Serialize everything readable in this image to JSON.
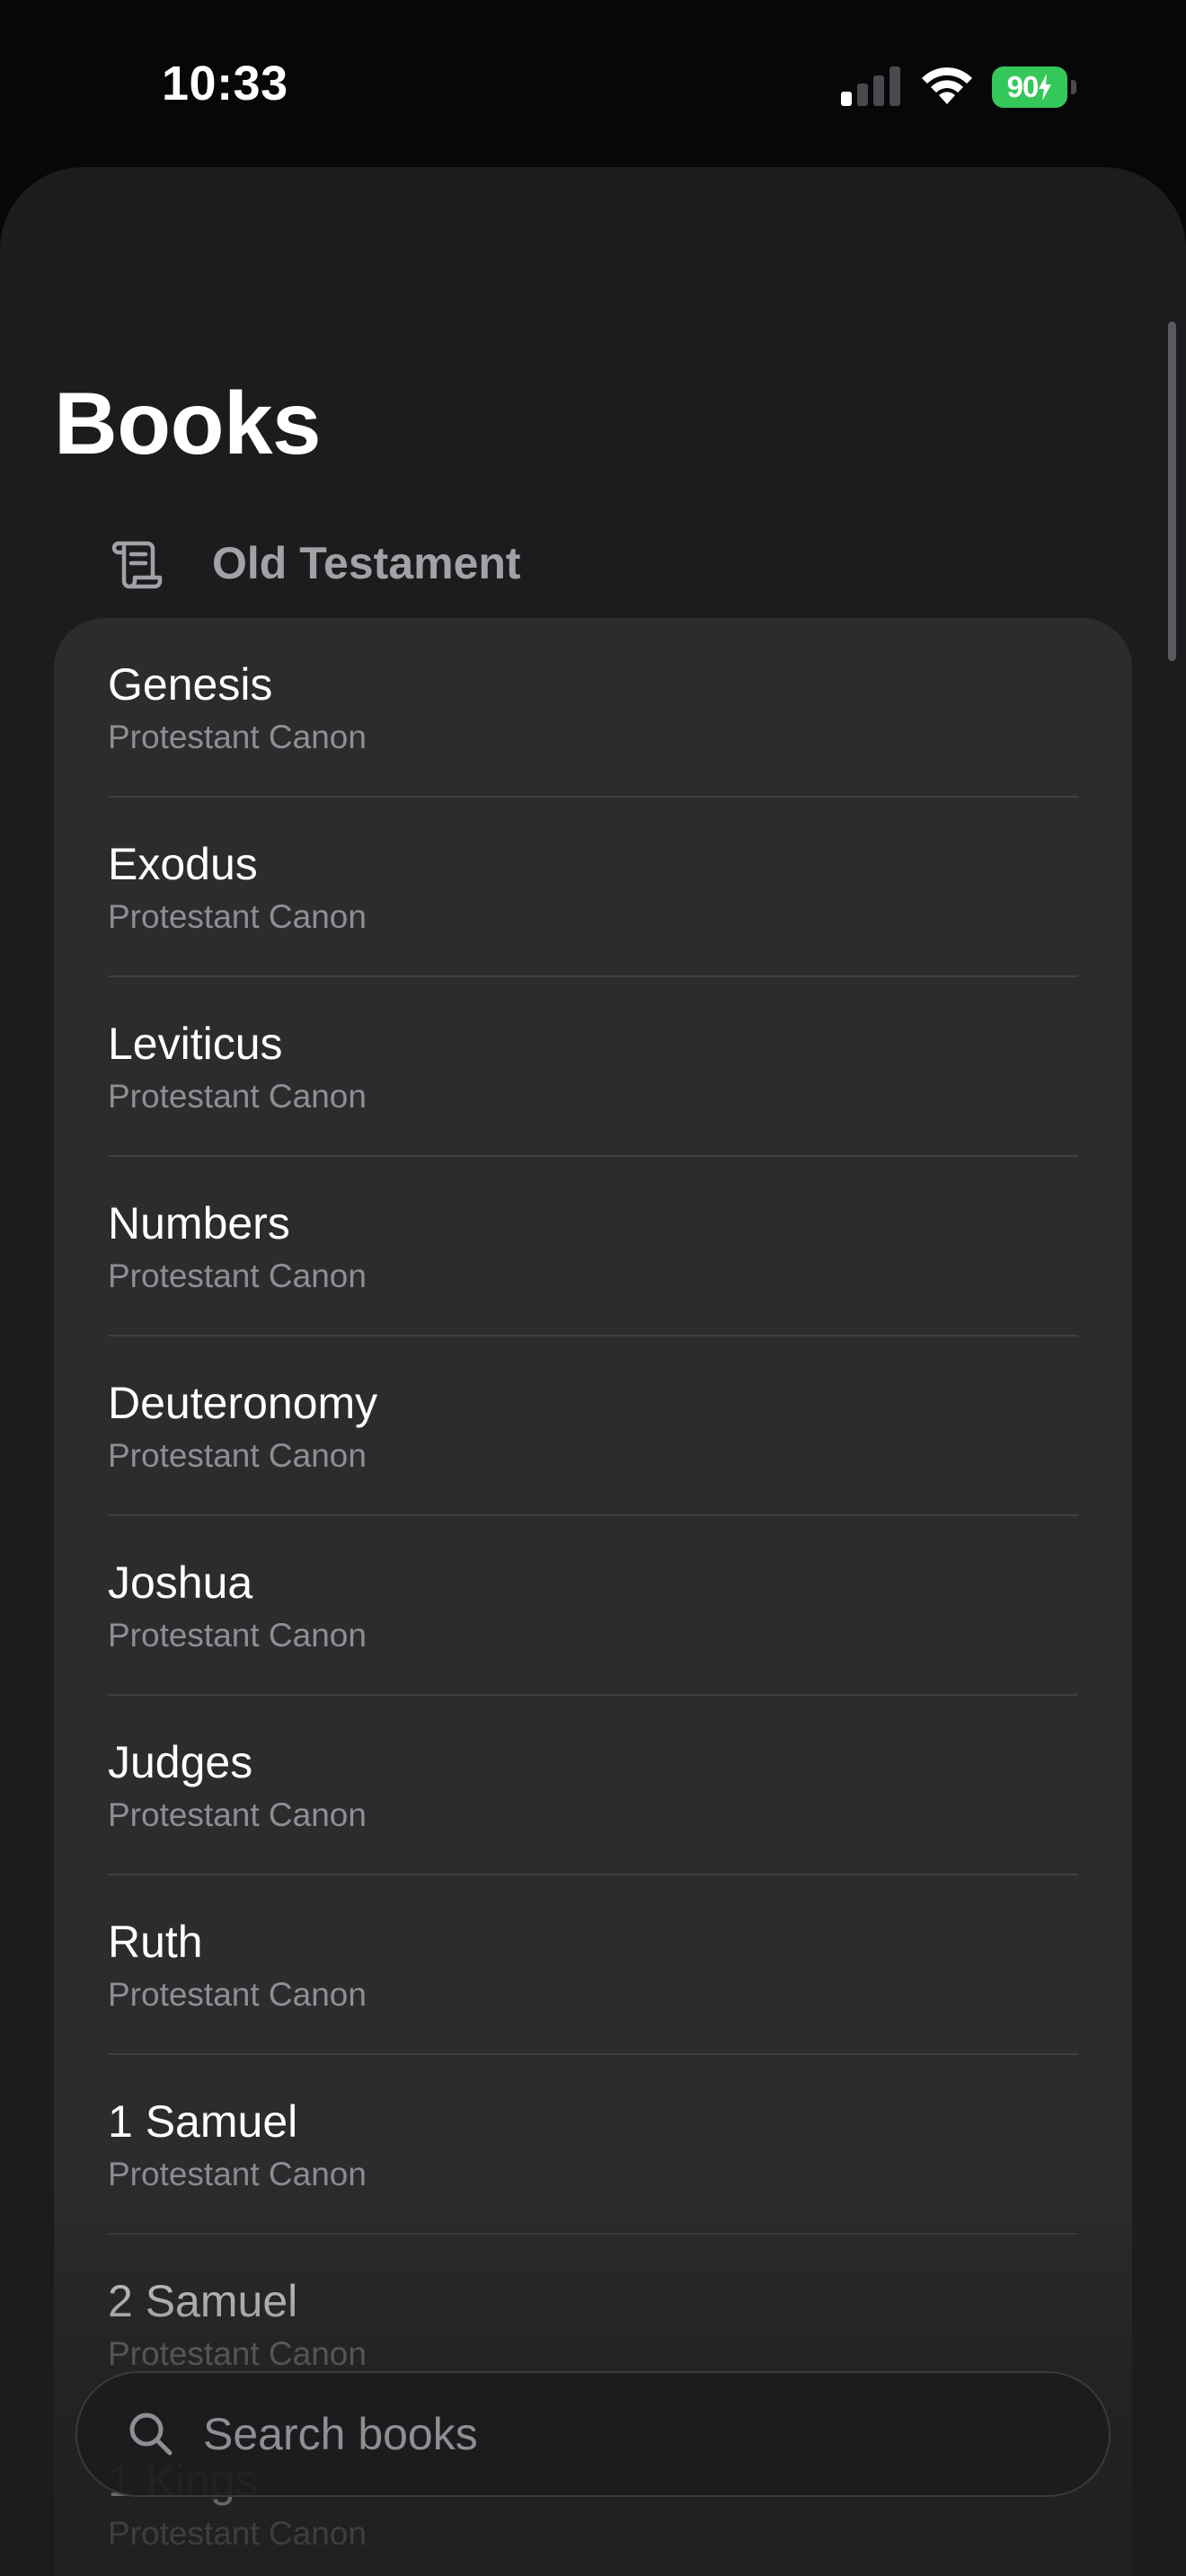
{
  "status_bar": {
    "time": "10:33",
    "battery_level": "90",
    "battery_charging": true,
    "signal_bars_active": 1,
    "signal_bars_total": 4,
    "icons": [
      "cellular-signal-icon",
      "wifi-icon",
      "battery-charging-icon"
    ]
  },
  "page": {
    "title": "Books"
  },
  "section": {
    "label": "Old Testament",
    "icon": "scroll-icon"
  },
  "books": [
    {
      "name": "Genesis",
      "canon": "Protestant Canon"
    },
    {
      "name": "Exodus",
      "canon": "Protestant Canon"
    },
    {
      "name": "Leviticus",
      "canon": "Protestant Canon"
    },
    {
      "name": "Numbers",
      "canon": "Protestant Canon"
    },
    {
      "name": "Deuteronomy",
      "canon": "Protestant Canon"
    },
    {
      "name": "Joshua",
      "canon": "Protestant Canon"
    },
    {
      "name": "Judges",
      "canon": "Protestant Canon"
    },
    {
      "name": "Ruth",
      "canon": "Protestant Canon"
    },
    {
      "name": "1 Samuel",
      "canon": "Protestant Canon"
    },
    {
      "name": "2 Samuel",
      "canon": "Protestant Canon"
    },
    {
      "name": "1 Kings",
      "canon": "Protestant Canon"
    }
  ],
  "search": {
    "placeholder": "Search books",
    "value": "",
    "icon": "magnifying-glass-icon"
  },
  "colors": {
    "background": "#070709",
    "sheet": "#1c1c1e",
    "card": "#2c2c2e",
    "primary_text": "#ffffff",
    "secondary_text": "#8e8e93",
    "battery_green": "#34c759"
  }
}
